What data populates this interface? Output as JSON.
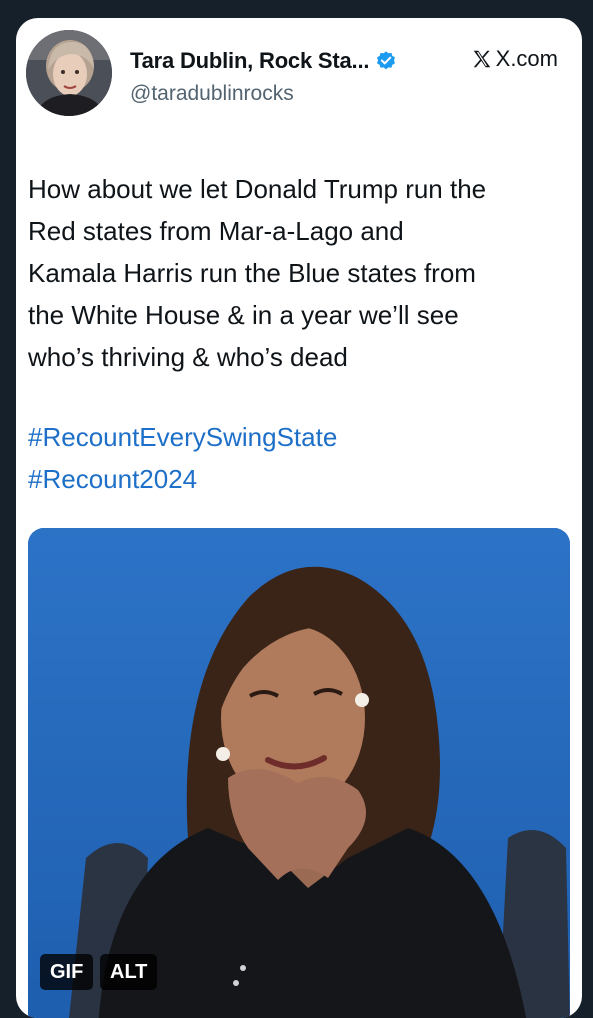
{
  "post": {
    "author_name": "Tara Dublin, Rock Sta...",
    "author_handle": "@taradublinrocks",
    "site_label": "X.com",
    "text_lines": [
      "How about we let Donald Trump run the",
      "Red states from Mar-a-Lago and",
      "Kamala Harris run the Blue states from",
      "the White House & in a year we’ll see",
      "who’s thriving & who’s dead"
    ],
    "hashtags": [
      "#RecountEverySwingState",
      "#Recount2024"
    ]
  },
  "media": {
    "gif_label": "GIF",
    "alt_label": "ALT"
  },
  "icons": {
    "verified": "verified-check-icon",
    "site": "x-logo-icon"
  },
  "colors": {
    "page_bg": "#15202b",
    "card_bg": "#ffffff",
    "link": "#1d6fc8",
    "verified": "#1d9bf0",
    "backdrop_blue": "#1f63b8"
  }
}
